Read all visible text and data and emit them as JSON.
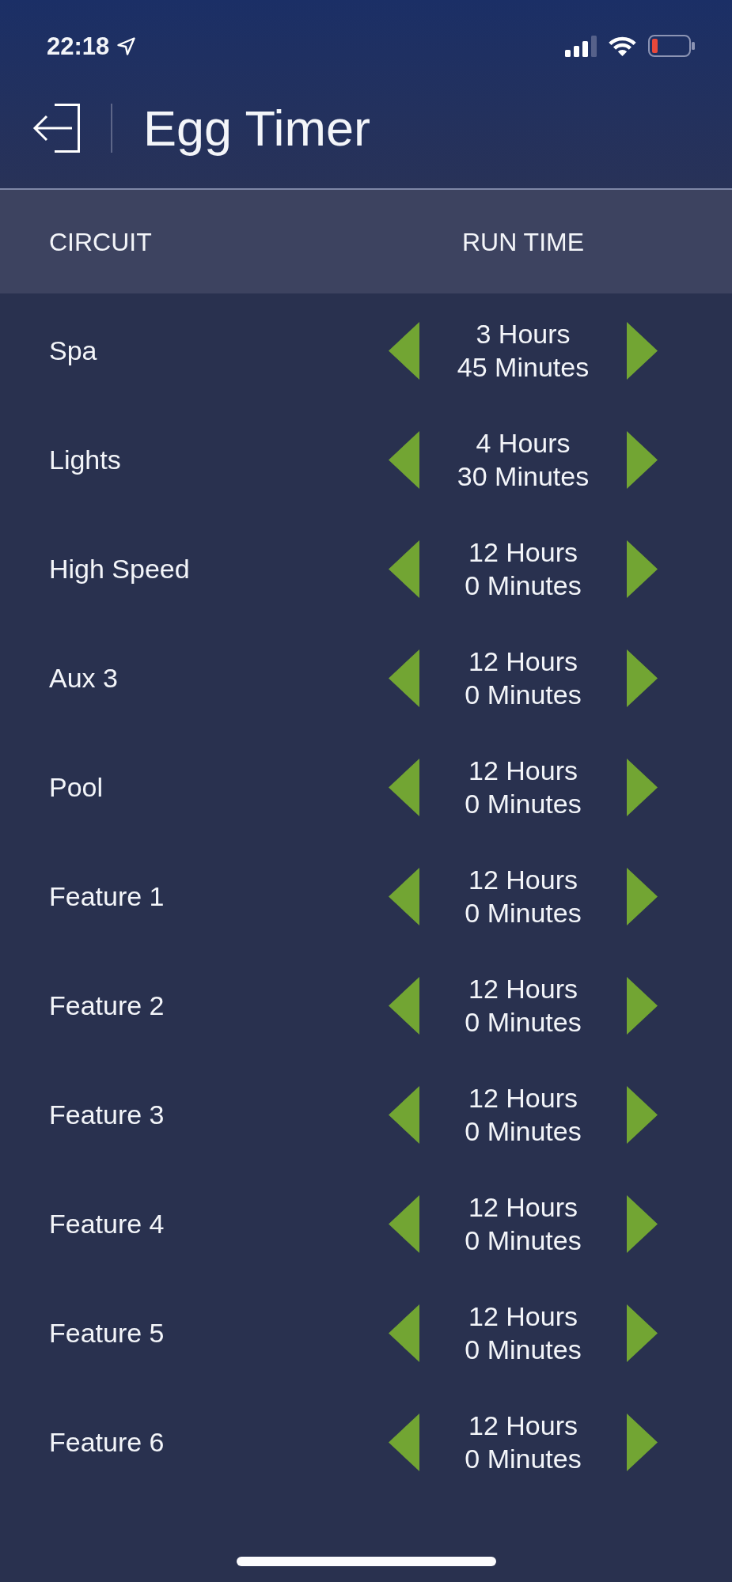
{
  "status_bar": {
    "time": "22:18"
  },
  "header": {
    "title": "Egg Timer"
  },
  "table": {
    "columns": [
      "CIRCUIT",
      "RUN TIME"
    ],
    "rows": [
      {
        "circuit": "Spa",
        "hours": "3 Hours",
        "minutes": "45 Minutes"
      },
      {
        "circuit": "Lights",
        "hours": "4 Hours",
        "minutes": "30 Minutes"
      },
      {
        "circuit": "High Speed",
        "hours": "12 Hours",
        "minutes": "0 Minutes"
      },
      {
        "circuit": "Aux 3",
        "hours": "12 Hours",
        "minutes": "0 Minutes"
      },
      {
        "circuit": "Pool",
        "hours": "12 Hours",
        "minutes": "0 Minutes"
      },
      {
        "circuit": "Feature 1",
        "hours": "12 Hours",
        "minutes": "0 Minutes"
      },
      {
        "circuit": "Feature 2",
        "hours": "12 Hours",
        "minutes": "0 Minutes"
      },
      {
        "circuit": "Feature 3",
        "hours": "12 Hours",
        "minutes": "0 Minutes"
      },
      {
        "circuit": "Feature 4",
        "hours": "12 Hours",
        "minutes": "0 Minutes"
      },
      {
        "circuit": "Feature 5",
        "hours": "12 Hours",
        "minutes": "0 Minutes"
      },
      {
        "circuit": "Feature 6",
        "hours": "12 Hours",
        "minutes": "0 Minutes"
      }
    ]
  }
}
